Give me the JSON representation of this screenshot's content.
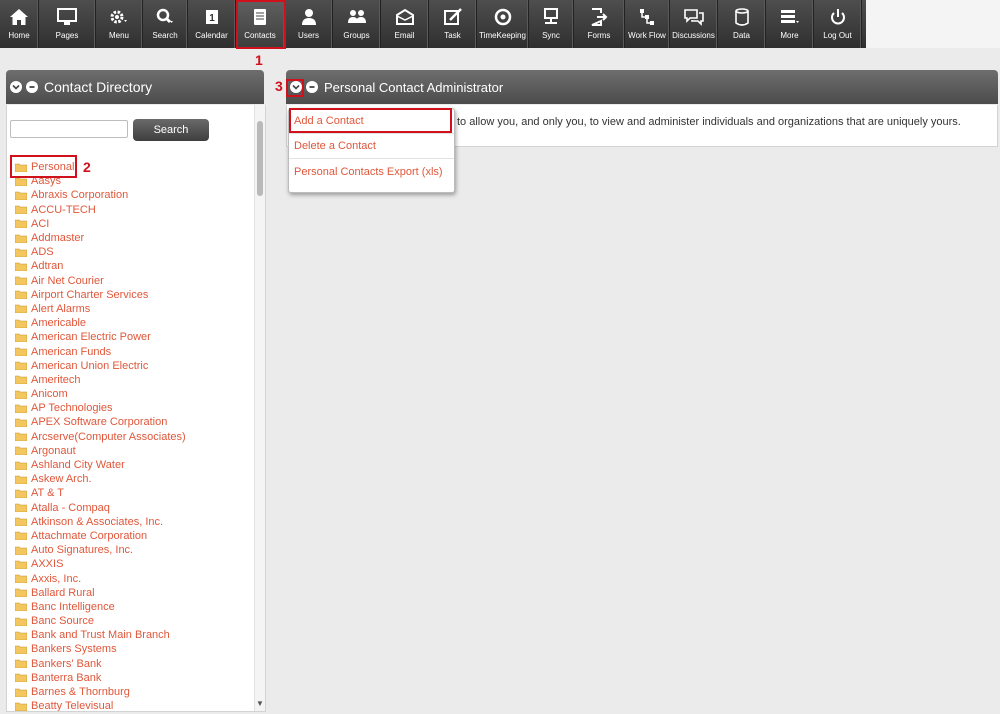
{
  "toolbar": {
    "items": [
      {
        "label": "Home",
        "icon": "home-icon"
      },
      {
        "label": "Pages",
        "icon": "monitor-icon"
      },
      {
        "label": "Menu",
        "icon": "gear-icon"
      },
      {
        "label": "Search",
        "icon": "search-icon"
      },
      {
        "label": "Calendar",
        "icon": "calendar-icon"
      },
      {
        "label": "Contacts",
        "icon": "contacts-icon"
      },
      {
        "label": "Users",
        "icon": "user-icon"
      },
      {
        "label": "Groups",
        "icon": "groups-icon"
      },
      {
        "label": "Email",
        "icon": "email-icon"
      },
      {
        "label": "Task",
        "icon": "task-icon"
      },
      {
        "label": "TimeKeeping",
        "icon": "timekeeping-icon"
      },
      {
        "label": "Sync",
        "icon": "sync-icon"
      },
      {
        "label": "Forms",
        "icon": "forms-icon"
      },
      {
        "label": "Work Flow",
        "icon": "workflow-icon"
      },
      {
        "label": "Discussions",
        "icon": "discussions-icon"
      },
      {
        "label": "Data",
        "icon": "data-icon"
      },
      {
        "label": "More",
        "icon": "more-icon"
      },
      {
        "label": "Log Out",
        "icon": "power-icon"
      }
    ],
    "active": "Contacts"
  },
  "annotations": {
    "one": "1",
    "two": "2",
    "three": "3",
    "color": "#d0111b"
  },
  "contact_directory": {
    "title": "Contact Directory",
    "search_button": "Search",
    "search_value": "",
    "items": [
      "Personal",
      "Aasys",
      "Abraxis Corporation",
      "ACCU-TECH",
      "ACI",
      "Addmaster",
      "ADS",
      "Adtran",
      "Air Net Courier",
      "Airport Charter Services",
      "Alert Alarms",
      "Americable",
      "American Electric Power",
      "American Funds",
      "American Union Electric",
      "Ameritech",
      "Anicom",
      "AP Technologies",
      "APEX Software Corporation",
      "Arcserve(Computer Associates)",
      "Argonaut",
      "Ashland City Water",
      "Askew Arch.",
      "AT & T",
      "Atalla - Compaq",
      "Atkinson & Associates, Inc.",
      "Attachmate Corporation",
      "Auto Signatures, Inc.",
      "AXXIS",
      "Axxis, Inc.",
      "Ballard Rural",
      "Banc Intelligence",
      "Banc Source",
      "Bank and Trust Main Branch",
      "Bankers Systems",
      "Bankers' Bank",
      "Banterra Bank",
      "Barnes & Thornburg",
      "Beatty Televisual"
    ]
  },
  "personal_admin": {
    "title": "Personal Contact Administrator",
    "description": "to allow you, and only you, to view and administer individuals and organizations that are uniquely yours.",
    "menu": [
      "Add a Contact",
      "Delete a Contact",
      "Personal Contacts Export (xls)"
    ]
  },
  "colors": {
    "link": "#e0573a",
    "toolbar": "#3a3a3a",
    "highlight": "#d0111b"
  }
}
